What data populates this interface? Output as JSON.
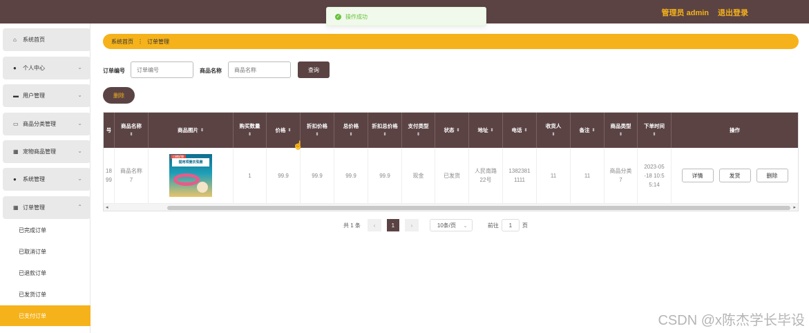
{
  "header": {
    "admin_label": "管理员 admin",
    "logout_label": "退出登录"
  },
  "toast": {
    "icon": "check-circle-icon",
    "message": "操作成功",
    "color": "#67c23a"
  },
  "colors": {
    "brand": "#5b4344",
    "accent": "#f5b21a"
  },
  "sidebar": {
    "items": [
      {
        "label": "系统首页",
        "icon": "home-icon"
      },
      {
        "label": "个人中心",
        "icon": "user-icon"
      },
      {
        "label": "用户管理",
        "icon": "monitor-icon"
      },
      {
        "label": "商品分类管理",
        "icon": "box-icon"
      },
      {
        "label": "宠物商品管理",
        "icon": "grid-icon"
      },
      {
        "label": "系统管理",
        "icon": "user-icon"
      },
      {
        "label": "订单管理",
        "icon": "grid-icon"
      }
    ],
    "sub_items": [
      {
        "label": "已完成订单"
      },
      {
        "label": "已取消订单"
      },
      {
        "label": "已退款订单"
      },
      {
        "label": "已发货订单"
      },
      {
        "label": "已支付订单",
        "active": true
      }
    ]
  },
  "breadcrumb": {
    "home": "系统首页",
    "separator": "⋮",
    "current": "订单管理"
  },
  "search": {
    "order_no_label": "订单编号",
    "order_no_placeholder": "订单编号",
    "product_name_label": "商品名称",
    "product_name_placeholder": "商品名称",
    "search_button": "查询"
  },
  "delete_button": "删除",
  "table": {
    "columns": [
      "号",
      "商品名称",
      "商品图片",
      "购买数量",
      "价格",
      "折扣价格",
      "总价格",
      "折扣总价格",
      "支付类型",
      "状态",
      "地址",
      "电话",
      "收货人",
      "备注",
      "商品类型",
      "下单时间",
      "操作"
    ],
    "rows": [
      {
        "order_no": "18\n99",
        "product_name": "商品名称\n7",
        "product_image": {
          "tag": "口碑好物",
          "banner": "猫用项圈去虱圈"
        },
        "quantity": "1",
        "price": "99.9",
        "discount_price": "99.9",
        "total_price": "99.9",
        "discount_total_price": "99.9",
        "pay_type": "现金",
        "status": "已发货",
        "address": "人民南路\n22号",
        "phone": "1382381\n1111",
        "receiver": "11",
        "remark": "11",
        "product_type": "商品分类\n7",
        "order_time": "2023-05\n-18 10:5\n5:14",
        "actions": {
          "detail": "详情",
          "ship": "发货",
          "delete": "删除"
        }
      }
    ]
  },
  "pagination": {
    "total": "共 1 条",
    "prev": "‹",
    "current_page": "1",
    "next": "›",
    "page_size": "10条/页",
    "goto_label": "前往",
    "goto_value": "1",
    "page_suffix": "页"
  },
  "watermark": "CSDN @x陈杰学长毕设"
}
